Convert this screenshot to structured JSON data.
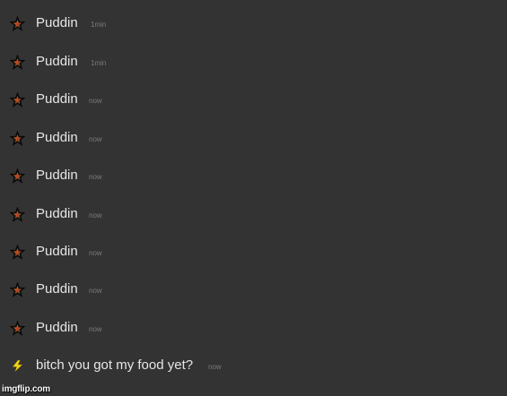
{
  "messages": [
    {
      "text": "Puddin",
      "time": "1min",
      "icon": "star-icon"
    },
    {
      "text": "Puddin",
      "time": "1min",
      "icon": "star-icon"
    },
    {
      "text": "Puddin",
      "time": "now",
      "icon": "star-icon"
    },
    {
      "text": "Puddin",
      "time": "now",
      "icon": "star-icon"
    },
    {
      "text": "Puddin",
      "time": "now",
      "icon": "star-icon"
    },
    {
      "text": "Puddin",
      "time": "now",
      "icon": "star-icon"
    },
    {
      "text": "Puddin",
      "time": "now",
      "icon": "star-icon"
    },
    {
      "text": "Puddin",
      "time": "now",
      "icon": "star-icon"
    },
    {
      "text": "Puddin",
      "time": "now",
      "icon": "star-icon"
    },
    {
      "text": "bitch you got my food yet?",
      "time": "now",
      "icon": "lightning-bolt-icon"
    }
  ],
  "watermark": "imgflip.com",
  "colors": {
    "background": "#333333",
    "name_text": "#e6e6e6",
    "time_text": "#7a7a7a"
  }
}
